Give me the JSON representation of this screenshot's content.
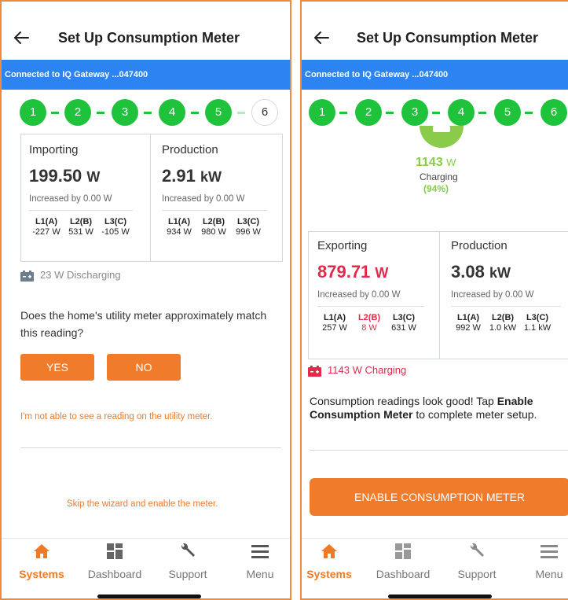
{
  "left": {
    "title": "Set Up Consumption Meter",
    "banner": "Connected to IQ Gateway ...047400",
    "steps": [
      "1",
      "2",
      "3",
      "4",
      "5",
      "6"
    ],
    "card1": {
      "label": "Importing",
      "value": "199.50",
      "unit": "W",
      "sub": "Increased by 0.00 W",
      "phases": [
        {
          "label": "L1(A)",
          "value": "-227 W"
        },
        {
          "label": "L2(B)",
          "value": "531 W"
        },
        {
          "label": "L3(C)",
          "value": "-105 W"
        }
      ]
    },
    "card2": {
      "label": "Production",
      "value": "2.91",
      "unit": "kW",
      "sub": "Increased by 0.00 W",
      "phases": [
        {
          "label": "L1(A)",
          "value": "934 W"
        },
        {
          "label": "L2(B)",
          "value": "980 W"
        },
        {
          "label": "L3(C)",
          "value": "996 W"
        }
      ]
    },
    "battery_status": "23 W Discharging",
    "question": "Does the home's utility meter approximately match this reading?",
    "yes_label": "YES",
    "no_label": "NO",
    "no_reading_link": "I'm not able to see a reading on the utility meter.",
    "skip_link": "Skip the wizard and enable the meter."
  },
  "right": {
    "title": "Set Up Consumption Meter",
    "banner": "Connected to IQ Gateway ...047400",
    "steps": [
      "1",
      "2",
      "3",
      "4",
      "5",
      "6"
    ],
    "battery_value": "1143",
    "battery_unit": "W",
    "battery_state": "Charging",
    "battery_pct": "(94%)",
    "card1": {
      "label": "Exporting",
      "value": "879.71",
      "unit": "W",
      "sub": "Increased by 0.00 W",
      "phases": [
        {
          "label": "L1(A)",
          "value": "257 W",
          "highlight": false
        },
        {
          "label": "L2(B)",
          "value": "8 W",
          "highlight": true
        },
        {
          "label": "L3(C)",
          "value": "631 W",
          "highlight": false
        }
      ]
    },
    "card2": {
      "label": "Production",
      "value": "3.08",
      "unit": "kW",
      "sub": "Increased by 0.00 W",
      "phases": [
        {
          "label": "L1(A)",
          "value": "992 W"
        },
        {
          "label": "L2(B)",
          "value": "1.0 kW"
        },
        {
          "label": "L3(C)",
          "value": "1.1 kW"
        }
      ]
    },
    "battery_status": "1143 W Charging",
    "message_pre": "Consumption readings look good! Tap ",
    "message_bold": "Enable Consumption Meter",
    "message_post": " to complete meter setup.",
    "enable_label": "ENABLE CONSUMPTION METER"
  },
  "tabs": [
    "Systems",
    "Dashboard",
    "Support",
    "Menu"
  ],
  "colors": {
    "accent": "#f07b2b",
    "banner": "#2b84f2",
    "step_done": "#1fc33b",
    "export_red": "#e02a4a",
    "charging_green": "#8acb4a"
  },
  "icons": {
    "back": "back-arrow-icon",
    "home": "home-icon",
    "dashboard": "dashboard-grid-icon",
    "support": "wrench-icon",
    "menu": "hamburger-icon",
    "battery": "battery-icon"
  }
}
